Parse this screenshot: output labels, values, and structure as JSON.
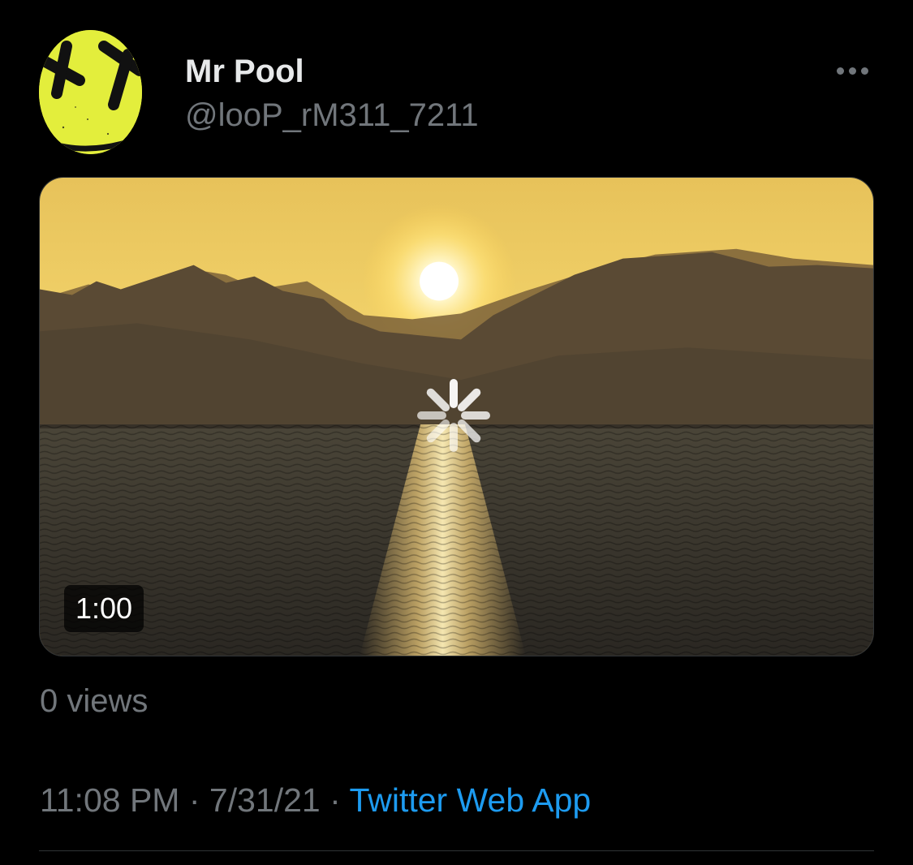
{
  "tweet": {
    "author": {
      "display_name": "Mr Pool",
      "handle": "@looP_rM311_7211",
      "avatar_icon": "yellow-face-x-eyes-avatar"
    },
    "more_icon": "more-horizontal-icon",
    "media": {
      "type": "video",
      "state": "loading",
      "duration": "1:00",
      "spinner_icon": "loading-spinner-icon"
    },
    "view_count": "0 views",
    "time": "11:08 PM",
    "separator": "·",
    "date": "7/31/21",
    "source": "Twitter Web App"
  },
  "colors": {
    "background": "#000000",
    "primary_text": "#e7e9ea",
    "secondary_text": "#71767b",
    "link": "#1d9bf0",
    "divider": "#2f3336",
    "avatar_yellow": "#e3ee3c"
  }
}
